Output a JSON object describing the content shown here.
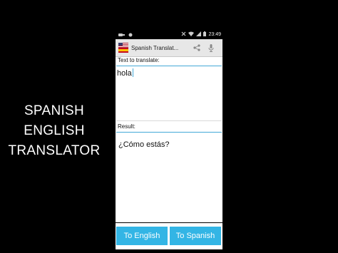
{
  "promo": {
    "lines": [
      "SPANISH",
      "ENGLISH",
      "TRANSLATOR"
    ]
  },
  "statusbar": {
    "time": "23:49",
    "left_icons": [
      "usb-icon",
      "debug-icon"
    ],
    "right_icons": [
      "mute-icon",
      "wifi-icon",
      "signal-icon",
      "battery-icon"
    ]
  },
  "actionbar": {
    "title": "Spanish Translat..."
  },
  "content": {
    "input_label": "Text to translate:",
    "input_value": "hola",
    "result_label": "Result:",
    "result_value": "¿Cómo estás?"
  },
  "buttons": {
    "to_english": "To English",
    "to_spanish": "To Spanish"
  },
  "colors": {
    "accent": "#33b5e5",
    "divider": "#43a9d8",
    "actionbar_bg": "#e7e7e7"
  }
}
